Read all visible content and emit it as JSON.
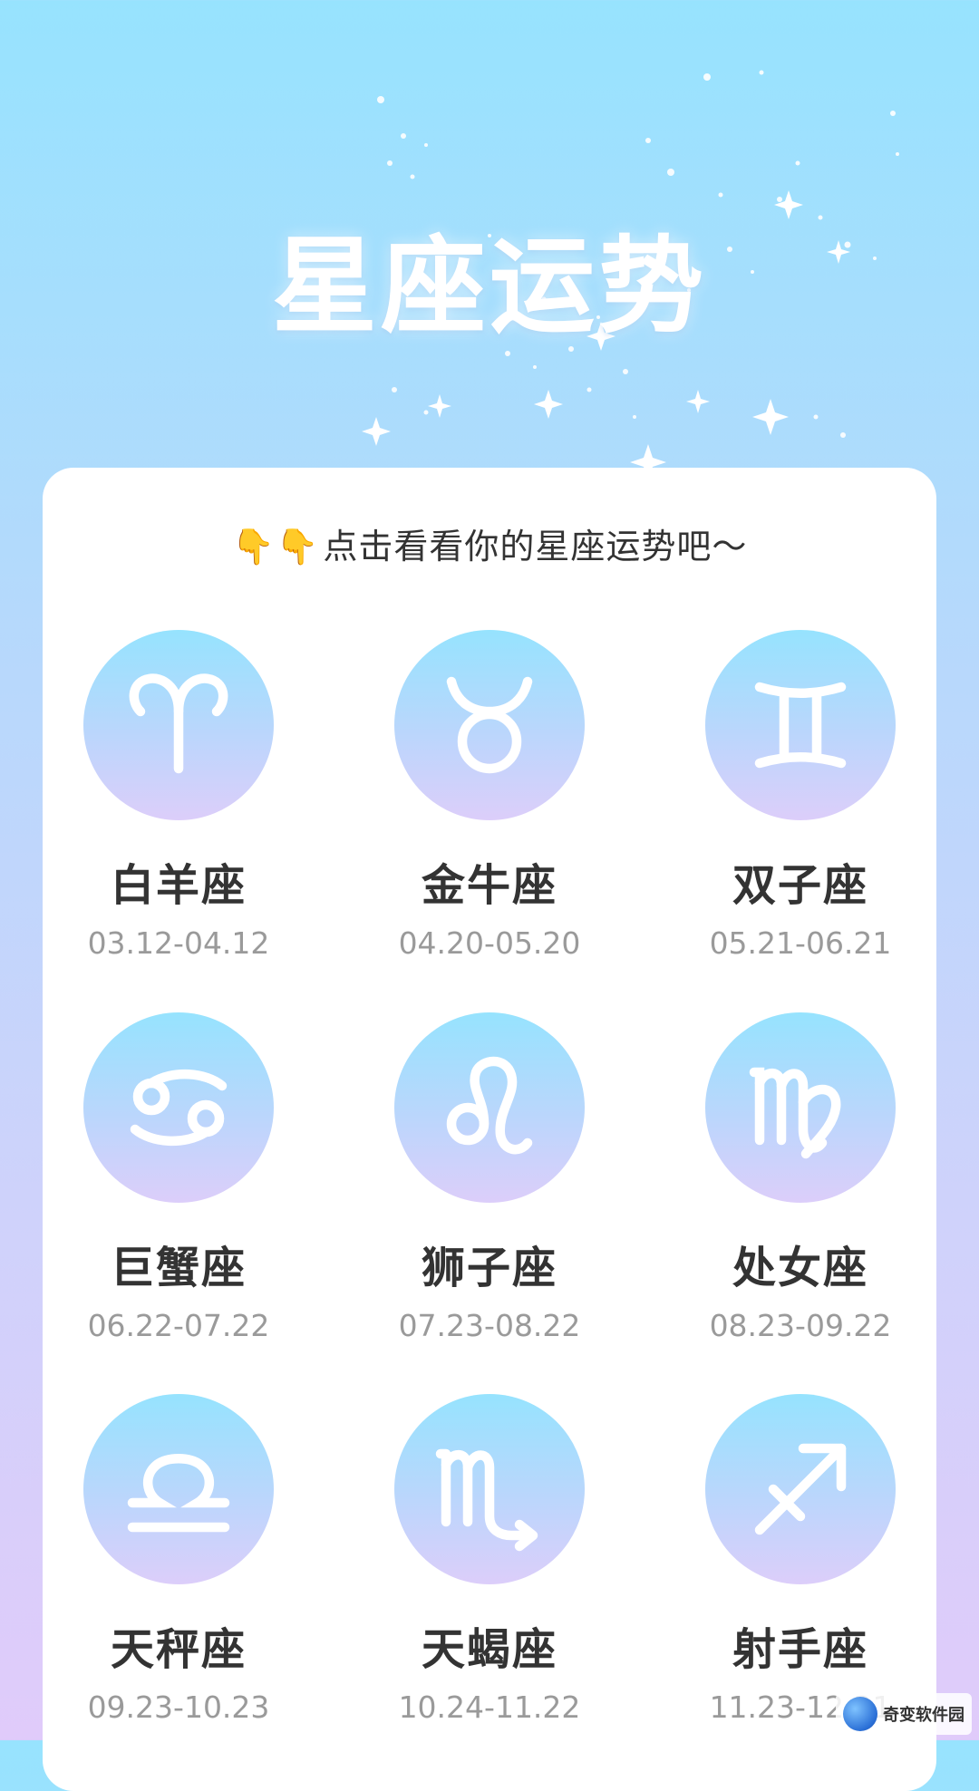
{
  "header": {
    "title": "星座运势"
  },
  "card": {
    "prompt_hands": "👇👇",
    "prompt": "点击看看你的星座运势吧～"
  },
  "signs": [
    {
      "name": "白羊座",
      "dates": "03.12-04.12",
      "icon": "aries-icon"
    },
    {
      "name": "金牛座",
      "dates": "04.20-05.20",
      "icon": "taurus-icon"
    },
    {
      "name": "双子座",
      "dates": "05.21-06.21",
      "icon": "gemini-icon"
    },
    {
      "name": "巨蟹座",
      "dates": "06.22-07.22",
      "icon": "cancer-icon"
    },
    {
      "name": "狮子座",
      "dates": "07.23-08.22",
      "icon": "leo-icon"
    },
    {
      "name": "处女座",
      "dates": "08.23-09.22",
      "icon": "virgo-icon"
    },
    {
      "name": "天秤座",
      "dates": "09.23-10.23",
      "icon": "libra-icon"
    },
    {
      "name": "天蝎座",
      "dates": "10.24-11.22",
      "icon": "scorpio-icon"
    },
    {
      "name": "射手座",
      "dates": "11.23-12.21",
      "icon": "sagittarius-icon"
    }
  ],
  "watermark": {
    "text": "奇变软件园"
  }
}
